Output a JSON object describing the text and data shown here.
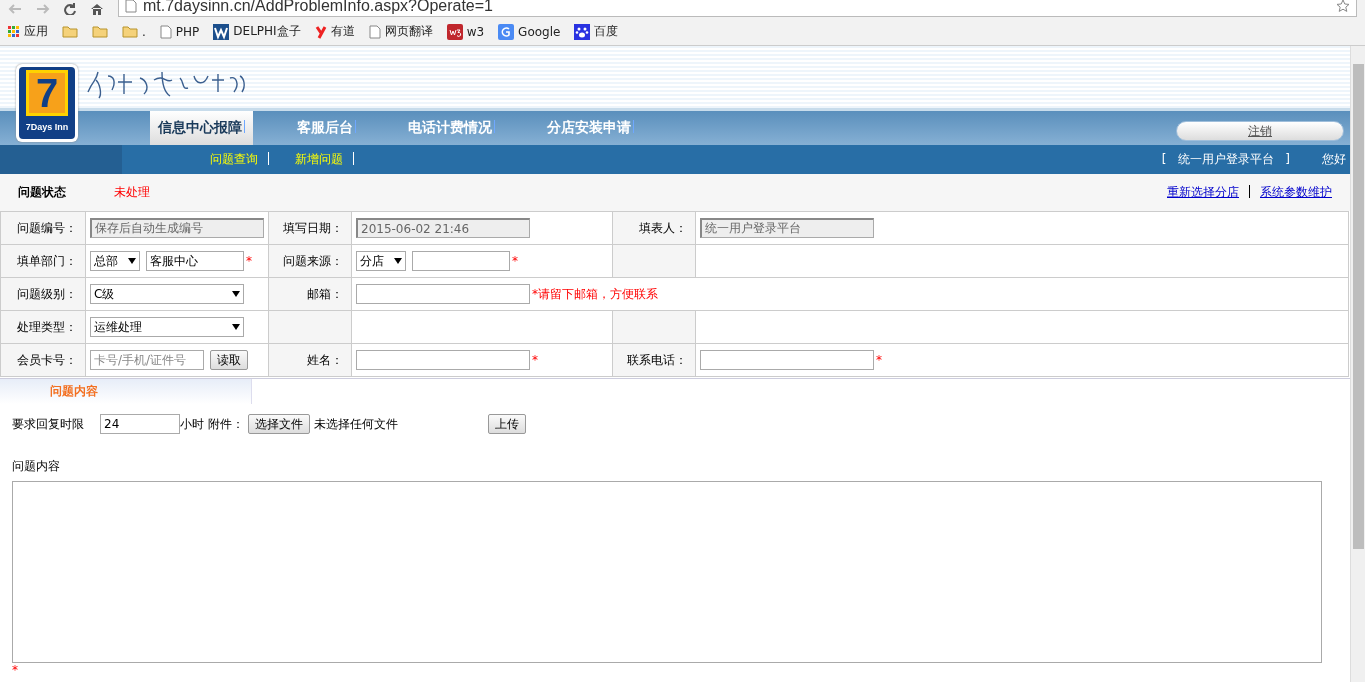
{
  "browser": {
    "url": "mt.7daysinn.cn/AddProblemInfo.aspx?Operate=1"
  },
  "bookmarks": [
    {
      "kind": "apps",
      "label": "应用"
    },
    {
      "kind": "folder"
    },
    {
      "kind": "folder"
    },
    {
      "kind": "folder",
      "label": "."
    },
    {
      "kind": "page",
      "label": "PHP"
    },
    {
      "kind": "delphi",
      "label": "DELPHI盒子"
    },
    {
      "kind": "youdao",
      "label": "有道"
    },
    {
      "kind": "page",
      "label": "网页翻译"
    },
    {
      "kind": "w3",
      "label": "w3"
    },
    {
      "kind": "google",
      "label": "Google"
    },
    {
      "kind": "baidu",
      "label": "百度"
    }
  ],
  "logo": {
    "number": "7",
    "name": "7Days Inn"
  },
  "nav": {
    "tabs": [
      {
        "label": "信息中心报障",
        "selected": true
      },
      {
        "label": "客服后台",
        "selected": false
      },
      {
        "label": "电话计费情况",
        "selected": false
      },
      {
        "label": "分店安装申请",
        "selected": false
      }
    ],
    "logout": "注销"
  },
  "subnav": {
    "links": [
      "问题查询",
      "新增问题"
    ],
    "platform": "[   统一用户登录平台   ]",
    "greeting": "您好"
  },
  "status": {
    "label": "问题状态",
    "value": "未处理",
    "links": [
      "重新选择分店",
      "系统参数维护"
    ]
  },
  "form_rows": [
    [
      {
        "kind": "field",
        "label": "问题编号：",
        "controls": [
          {
            "kind": "readonly",
            "value": "保存后自动生成编号"
          }
        ]
      },
      {
        "kind": "field",
        "label": "填写日期：",
        "controls": [
          {
            "kind": "readonly",
            "value": "2015-06-02 21:46"
          }
        ]
      },
      {
        "kind": "field",
        "label": "填表人：",
        "controls": [
          {
            "kind": "readonly",
            "value": "统一用户登录平台"
          }
        ]
      }
    ],
    [
      {
        "kind": "field",
        "label": "填单部门：",
        "controls": [
          {
            "kind": "select",
            "value": "总部"
          },
          {
            "kind": "input",
            "value": "客服中心"
          },
          {
            "kind": "required",
            "text": "*"
          }
        ]
      },
      {
        "kind": "field",
        "label": "问题来源：",
        "controls": [
          {
            "kind": "select",
            "value": "分店"
          },
          {
            "kind": "input"
          },
          {
            "kind": "required",
            "text": "*"
          }
        ]
      },
      {
        "kind": "blank"
      }
    ],
    [
      {
        "kind": "field",
        "label": "问题级别：",
        "controls": [
          {
            "kind": "wide_select",
            "value": "C级"
          }
        ]
      },
      {
        "kind": "wide",
        "label": "邮箱：",
        "controls": [
          {
            "kind": "input"
          },
          {
            "kind": "required",
            "text": "*请留下邮箱，方便联系"
          }
        ]
      }
    ],
    [
      {
        "kind": "field",
        "label": "处理类型：",
        "controls": [
          {
            "kind": "wide_select",
            "value": "运维处理"
          }
        ]
      },
      {
        "kind": "blank"
      },
      {
        "kind": "blank"
      }
    ],
    [
      {
        "kind": "field",
        "label": "会员卡号：",
        "controls": [
          {
            "kind": "input",
            "placeholder": "卡号/手机/证件号"
          },
          {
            "kind": "button",
            "text": "读取"
          }
        ]
      },
      {
        "kind": "field",
        "label": "姓名：",
        "controls": [
          {
            "kind": "input"
          },
          {
            "kind": "required",
            "text": "*"
          }
        ]
      },
      {
        "kind": "field",
        "label": "联系电话：",
        "controls": [
          {
            "kind": "input"
          },
          {
            "kind": "required",
            "text": "*"
          }
        ]
      }
    ]
  ],
  "content_tabs": [
    {
      "label": "问题内容",
      "selected": true
    }
  ],
  "reply": {
    "label": "要求回复时限",
    "hours": "24",
    "unit": "小时",
    "attach_label": "附件：",
    "choose_button": "选择文件",
    "no_file": "未选择任何文件",
    "upload_button": "上传"
  },
  "content": {
    "label": "问题内容",
    "required": "*"
  }
}
